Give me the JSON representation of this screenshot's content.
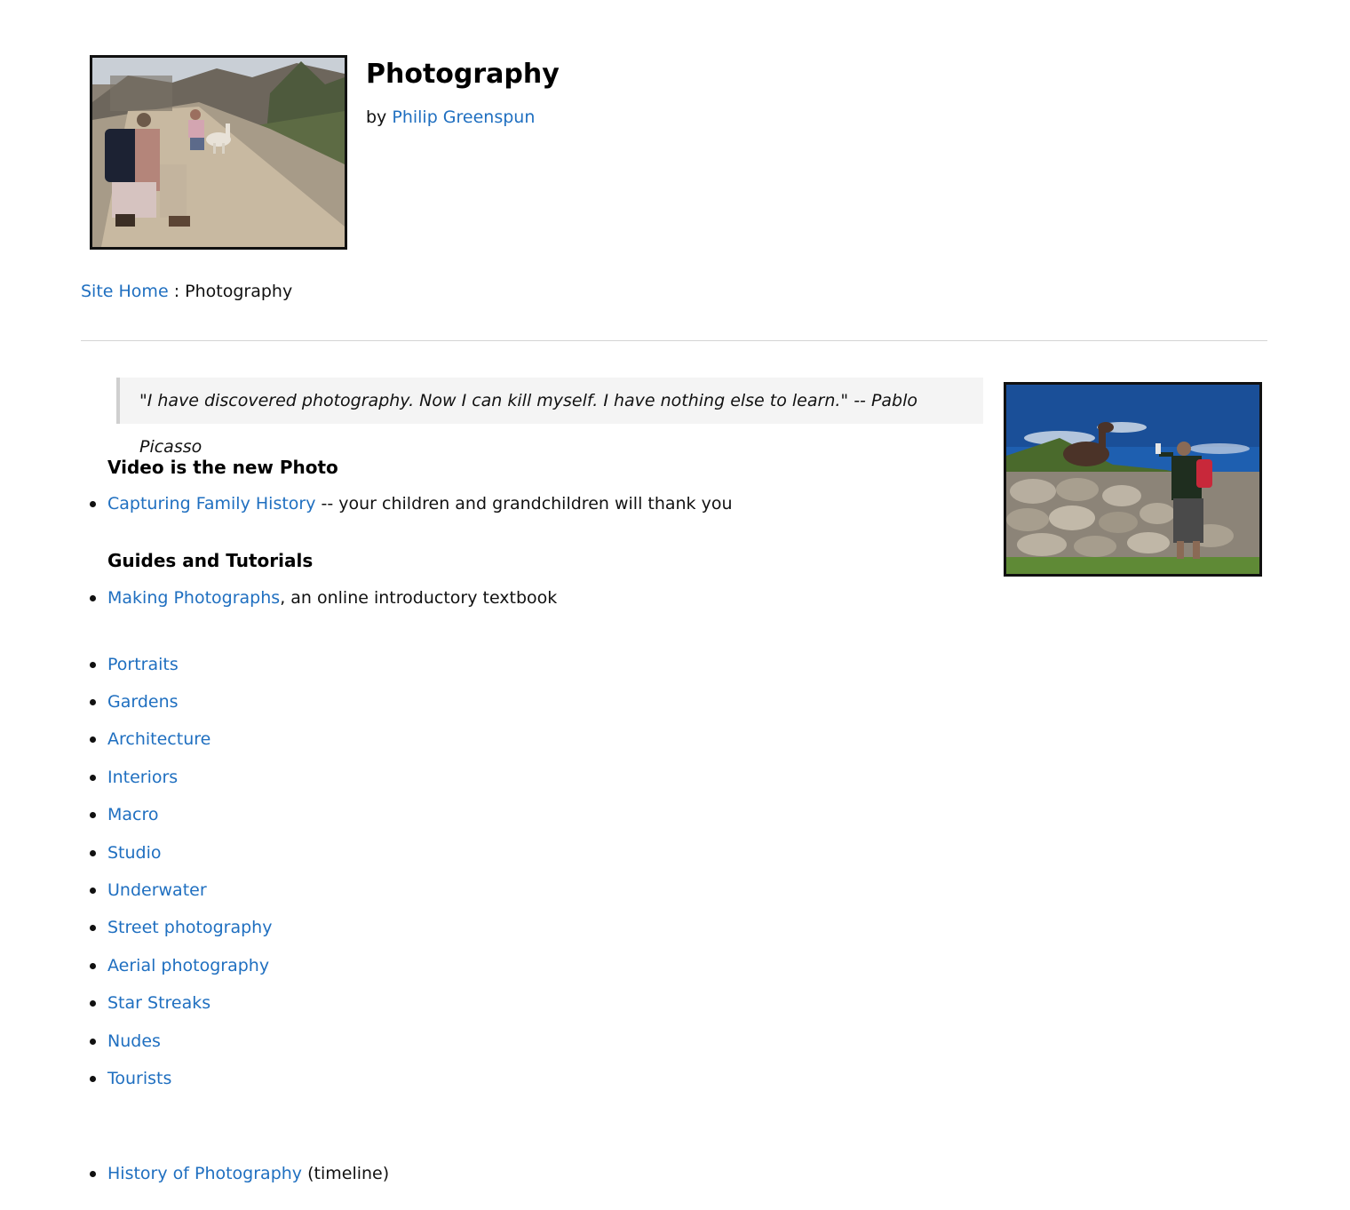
{
  "header": {
    "title": "Photography",
    "by_prefix": "by",
    "author": "Philip Greenspun"
  },
  "breadcrumb": {
    "home": "Site Home",
    "separator": ":",
    "current": "Photography"
  },
  "quote": {
    "text": "\"I have discovered photography. Now I can kill myself. I have nothing else to learn.\" -- Pablo Picasso"
  },
  "video_section": {
    "heading": "Video is the new Photo",
    "item_link": "Capturing Family History",
    "item_suffix": " -- your children and grandchildren will thank you"
  },
  "guides_section": {
    "heading": "Guides and Tutorials",
    "item_link": "Making Photographs",
    "item_suffix": ", an online introductory textbook"
  },
  "topics": [
    "Portraits",
    "Gardens",
    "Architecture",
    "Interiors",
    "Macro",
    "Studio",
    "Underwater",
    "Street photography",
    "Aerial photography",
    "Star Streaks",
    "Nudes",
    "Tourists"
  ],
  "history": {
    "link": "History of Photography",
    "suffix": " (timeline)"
  },
  "colors": {
    "link": "#1f6fc0",
    "text": "#111111",
    "quote_background": "#f4f4f4",
    "divider": "#d4d4d4"
  }
}
